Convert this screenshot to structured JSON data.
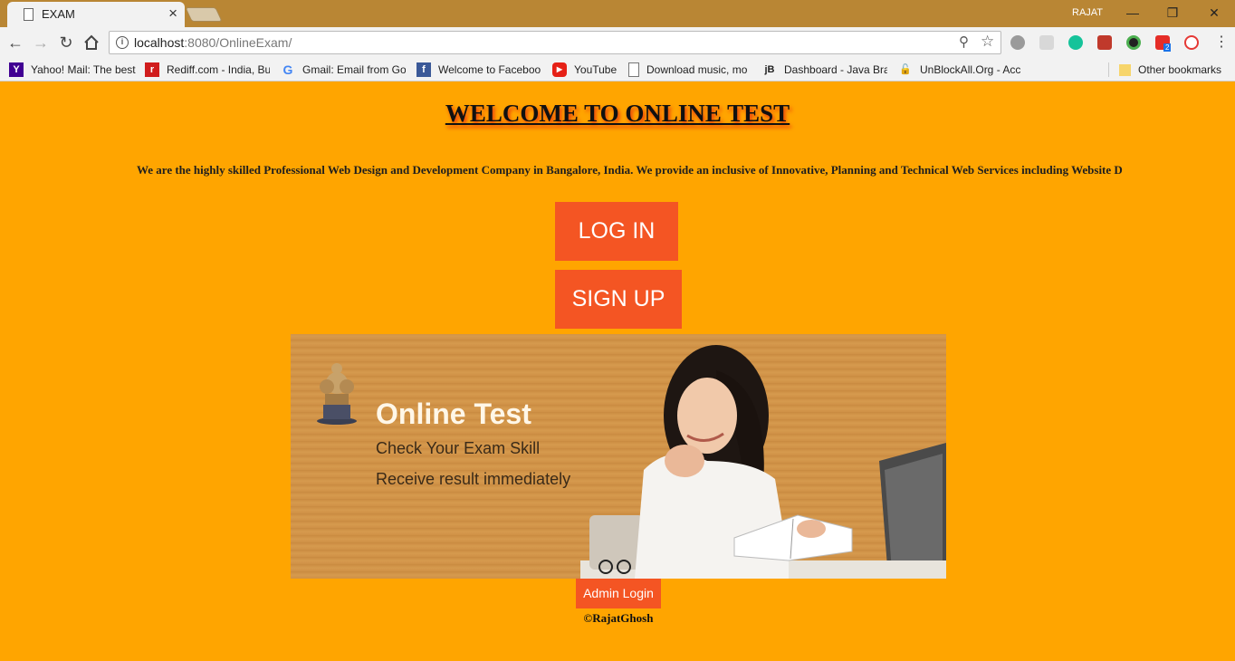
{
  "browser": {
    "tab_title": "EXAM",
    "tab_close": "×",
    "user": "RAJAT",
    "url_host": "localhost",
    "url_path": ":8080/OnlineExam/",
    "ext_badge": "2",
    "bookmarks": [
      {
        "label": "Yahoo! Mail: The best",
        "icon": "Y",
        "color": "#410093"
      },
      {
        "label": "Rediff.com - India, Bu",
        "icon": "r",
        "color": "#d01c1c"
      },
      {
        "label": "Gmail: Email from Go",
        "icon": "G",
        "color": "#4285f4"
      },
      {
        "label": "Welcome to Faceboo",
        "icon": "f",
        "color": "#3b5998"
      },
      {
        "label": "YouTube",
        "icon": "▶",
        "color": "#e62117"
      },
      {
        "label": "Download music, mo",
        "icon": "",
        "color": "#ffffff"
      },
      {
        "label": "Dashboard - Java Bra",
        "icon": "jB",
        "color": "#f2f2f2"
      },
      {
        "label": "UnBlockAll.Org - Acc",
        "icon": "🔓",
        "color": "#f2f2f2"
      }
    ],
    "other_bookmarks": "Other bookmarks"
  },
  "page": {
    "title": "WELCOME TO ONLINE TEST",
    "marquee": "We are the highly skilled Professional Web Design and Development Company in Bangalore, India. We provide an inclusive of Innovative, Planning and Technical Web Services including Website D",
    "login_label": "LOG IN",
    "signup_label": "SIGN UP",
    "admin_label": "Admin Login",
    "copyright": "©RajatGhosh"
  },
  "banner": {
    "title": "Online Test",
    "line1": "Check Your Exam Skill",
    "line2": "Receive result immediately"
  },
  "colors": {
    "page_bg": "#ffa500",
    "button": "#f45523",
    "title_shadow": "#e8360c",
    "browser_frame": "#b98634"
  }
}
